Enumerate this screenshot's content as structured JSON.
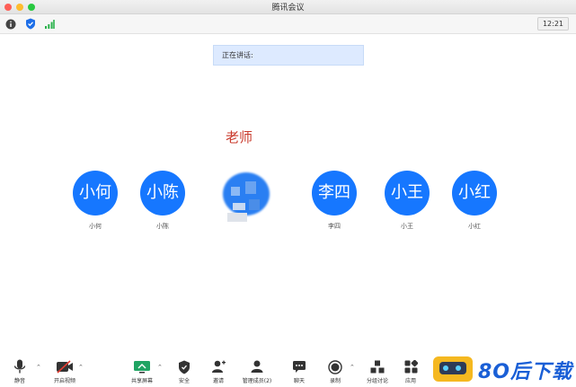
{
  "window": {
    "title": "腾讯会议"
  },
  "toolbar": {
    "clock": "12:21"
  },
  "speaking": {
    "label": "正在讲话:"
  },
  "stage": {
    "teacher_label": "老师"
  },
  "participants": [
    {
      "avatar_text": "小何",
      "name": "小何"
    },
    {
      "avatar_text": "小陈",
      "name": "小陈"
    },
    {
      "avatar_text": "李四",
      "name": "李四"
    },
    {
      "avatar_text": "小王",
      "name": "小王"
    },
    {
      "avatar_text": "小红",
      "name": "小红"
    }
  ],
  "bottom": {
    "mute": "静音",
    "video": "开启视频",
    "share": "共享屏幕",
    "security": "安全",
    "invite": "邀请",
    "members": "管理成员(2)",
    "chat": "聊天",
    "record": "录制",
    "breakout": "分组讨论",
    "apps": "应用"
  },
  "watermark": {
    "text": "8O后下载"
  },
  "colors": {
    "avatar": "#1677ff",
    "teacher": "#c9382a",
    "banner": "#ddeaff"
  }
}
